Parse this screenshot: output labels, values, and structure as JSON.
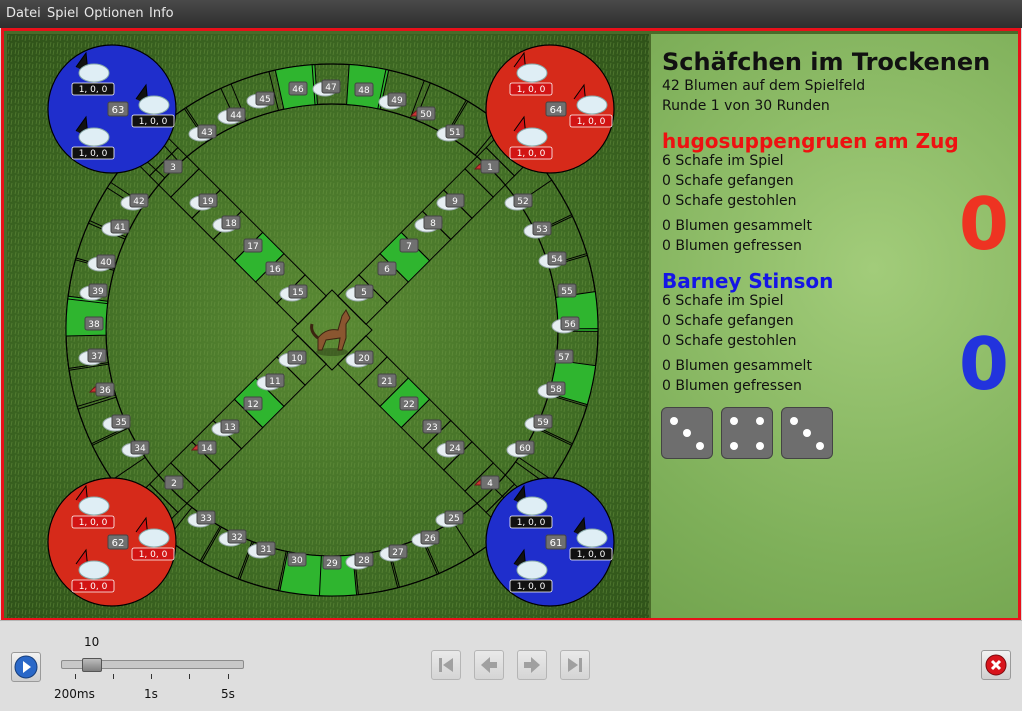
{
  "menu": [
    "Datei",
    "Spiel",
    "Optionen",
    "Info"
  ],
  "game": {
    "title": "Schäfchen im Trockenen",
    "flowers_info": "42 Blumen auf dem Spielfeld",
    "round_info": "Runde 1 von 30 Runden"
  },
  "colors": {
    "red": "#ee1111",
    "blue": "#1515e6",
    "frame": "#e8101a",
    "green_field": "#2fb52f"
  },
  "players": [
    {
      "name": "hugosuppengruen am Zug",
      "color": "#ee1111",
      "score": "0",
      "stats": [
        "6 Schafe im Spiel",
        "0 Schafe gefangen",
        "0 Schafe gestohlen",
        "0 Blumen gesammelt",
        "0 Blumen gefressen"
      ]
    },
    {
      "name": "Barney Stinson",
      "color": "#1515e6",
      "score": "0",
      "stats": [
        "6 Schafe im Spiel",
        "0 Schafe gefangen",
        "0 Schafe gestohlen",
        "0 Blumen gesammelt",
        "0 Blumen gefressen"
      ]
    }
  ],
  "dice": [
    3,
    4,
    3
  ],
  "board": {
    "outer_ring_start": 25,
    "outer_ring_end": 56,
    "green_outer": [
      29,
      30,
      38,
      46,
      48,
      55,
      57
    ],
    "green_diag": [
      7,
      12,
      17,
      22
    ],
    "outer_labels": [
      "25",
      "26",
      "27",
      "28",
      "29",
      "30",
      "31",
      "32",
      "33",
      "34",
      "35",
      "36",
      "37",
      "38",
      "39",
      "40",
      "41",
      "42",
      "43",
      "44",
      "45",
      "46",
      "47",
      "48",
      "49",
      "50",
      "51",
      "52",
      "53",
      "54",
      "55",
      "56",
      "57",
      "58",
      "59",
      "60"
    ],
    "diag_ne": [
      "5",
      "6",
      "7",
      "8",
      "9",
      "1"
    ],
    "diag_se": [
      "20",
      "21",
      "22",
      "23",
      "24",
      "4"
    ],
    "diag_sw": [
      "10",
      "11",
      "12",
      "13",
      "14",
      "2"
    ],
    "diag_nw": [
      "15",
      "16",
      "17",
      "18",
      "19",
      "3"
    ],
    "bases": [
      {
        "label": "63",
        "color": "#1f2ecc",
        "sheep": [
          "1, 0, 0",
          "1, 0, 0",
          "1, 0, 0"
        ],
        "owner": "blue"
      },
      {
        "label": "64",
        "color": "#d62a1a",
        "sheep": [
          "1, 0, 0",
          "1, 0, 0",
          "1, 0, 0"
        ],
        "owner": "red"
      },
      {
        "label": "62",
        "color": "#d62a1a",
        "sheep": [
          "1, 0, 0",
          "1, 0, 0",
          "1, 0, 0"
        ],
        "owner": "red"
      },
      {
        "label": "61",
        "color": "#1f2ecc",
        "sheep": [
          "1, 0, 0",
          "1, 0, 0",
          "1, 0, 0"
        ],
        "owner": "blue"
      }
    ]
  },
  "speed": {
    "value": "10",
    "ticks": [
      "200ms",
      "1s",
      "5s"
    ],
    "level": 0.12
  }
}
